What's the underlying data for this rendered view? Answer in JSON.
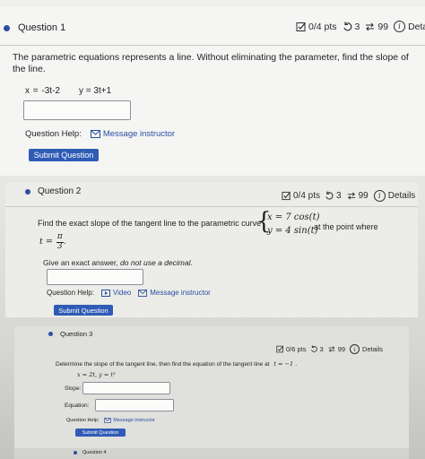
{
  "q1": {
    "title": "Question 1",
    "points": "0/4 pts",
    "retries": "3",
    "attempts": "99",
    "details": "Deta",
    "prompt": "The parametric equations represents a line. Without eliminating the parameter, find the slope of the line.",
    "eq_x": "x = -3t-2",
    "eq_y": "y = 3t+1",
    "answer_value": "",
    "help_label": "Question Help:",
    "message_label": "Message instructor",
    "submit_label": "Submit Question"
  },
  "q2": {
    "title": "Question 2",
    "points": "0/4 pts",
    "retries": "3",
    "attempts": "99",
    "details": "Details",
    "prompt": "Find the exact slope of the tangent line to the parametric curve",
    "sys_x": "x = 7 cos(t)",
    "sys_y": "y = 4 sin(t)",
    "at_point": "at the point where",
    "t_eq": "t =",
    "t_num": "π",
    "t_den": "3",
    "t_end": ".",
    "note_prefix": "Give an exact answer,",
    "note_emph": "do not use a decimal.",
    "answer_value": "",
    "help_label": "Question Help:",
    "video_label": "Video",
    "message_label": "Message instructor",
    "submit_label": "Submit Question"
  },
  "q3": {
    "title": "Question 3",
    "points": "0/6 pts",
    "retries": "3",
    "attempts": "99",
    "details": "Details",
    "prompt": "Determine the slope of the tangent line, then find the equation of the tangent line at",
    "t_value": "t = −1 .",
    "eqs": "x = 2t, y = t³",
    "slope_label": "Slope:",
    "equation_label": "Equation:",
    "help_label": "Question Help:",
    "message_label": "Message instructor",
    "submit_label": "Submit Question"
  },
  "q4": {
    "title": "Question 4"
  },
  "colors": {
    "accent": "#2a4ea3",
    "submit_bg": "#2f5bb5"
  }
}
